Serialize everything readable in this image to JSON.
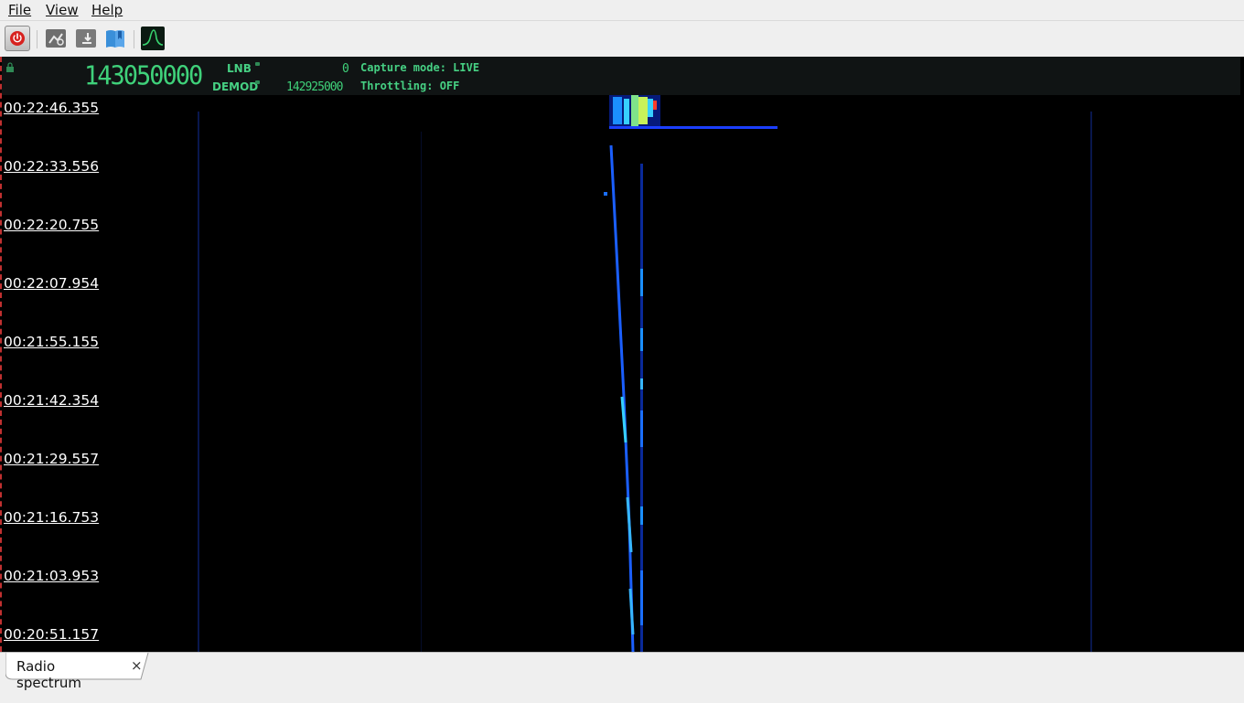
{
  "menu": {
    "file": "File",
    "view": "View",
    "help": "Help"
  },
  "toolbar": {
    "icons": [
      "power-icon",
      "settings-icon",
      "import-icon",
      "bookmarks-icon",
      "spectrum-icon"
    ],
    "power_color": "#d7221f",
    "bookmark_color": "#3a8fd9"
  },
  "header": {
    "frequency": "143050000",
    "lnb_label": "LNB",
    "demod_label": "DEMOD",
    "lnb_value": "0",
    "demod_value": "142925000",
    "capture_mode": "Capture mode: LIVE",
    "throttling": "Throttling: OFF",
    "lcd_color": "#3fd17a"
  },
  "waterfall": {
    "timestamps": [
      "00:22:46.355",
      "00:22:33.556",
      "00:22:20.755",
      "00:22:07.954",
      "00:21:55.155",
      "00:21:42.354",
      "00:21:29.557",
      "00:21:16.753",
      "00:21:03.953",
      "00:20:51.157"
    ]
  },
  "tabs": [
    {
      "label": "Radio spectrum",
      "close": "×"
    }
  ]
}
